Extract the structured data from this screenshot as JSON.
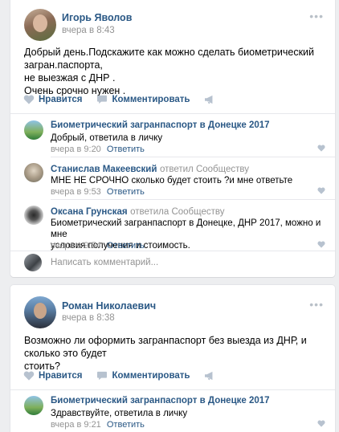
{
  "colors": {
    "link": "#2a5885",
    "muted": "#939393",
    "bg": "#edeef0"
  },
  "post1": {
    "author": "Игорь Яволов",
    "date": "вчера в 8:43",
    "text_lines": [
      "Добрый день.Подскажите как можно сделать биометрический загран.паспорта,",
      "не выезжая с ДНР .",
      "Очень срочно нужен ."
    ],
    "actions": {
      "like": "Нравится",
      "comment": "Комментировать"
    },
    "comments": [
      {
        "name": "Биометрический загранпаспорт в Донецке 2017",
        "sub": "",
        "lines": [
          "Добрый, ответила в личку"
        ],
        "time": "вчера в 9:20",
        "reply": "Ответить"
      },
      {
        "name": "Станислав Макеевский",
        "sub": "ответил Сообществу",
        "lines": [
          "МНЕ НЕ СРОЧНО сколько будет стоить ?и мне ответьте"
        ],
        "time": "вчера в 9:53",
        "reply": "Ответить"
      },
      {
        "name": "Оксана Грунская",
        "sub": "ответила Сообществу",
        "lines": [
          "Биометрический загранпаспорт в Донецке, ДНР 2017, можно и мне",
          "условия получения и стоимость."
        ],
        "time": "вчера в 9:54",
        "reply": "Ответить"
      }
    ],
    "comment_placeholder": "Написать комментарий..."
  },
  "post2": {
    "author": "Роман Николаевич",
    "date": "вчера в 8:38",
    "text_lines": [
      "Возможно ли оформить загранпаспорт без выезда из ДНР, и сколько это будет",
      "стоить?"
    ],
    "actions": {
      "like": "Нравится",
      "comment": "Комментировать"
    },
    "comments": [
      {
        "name": "Биометрический загранпаспорт в Донецке 2017",
        "sub": "",
        "lines": [
          "Здравствуйте, ответила в личку"
        ],
        "time": "вчера в 9:21",
        "reply": "Ответить"
      }
    ]
  }
}
